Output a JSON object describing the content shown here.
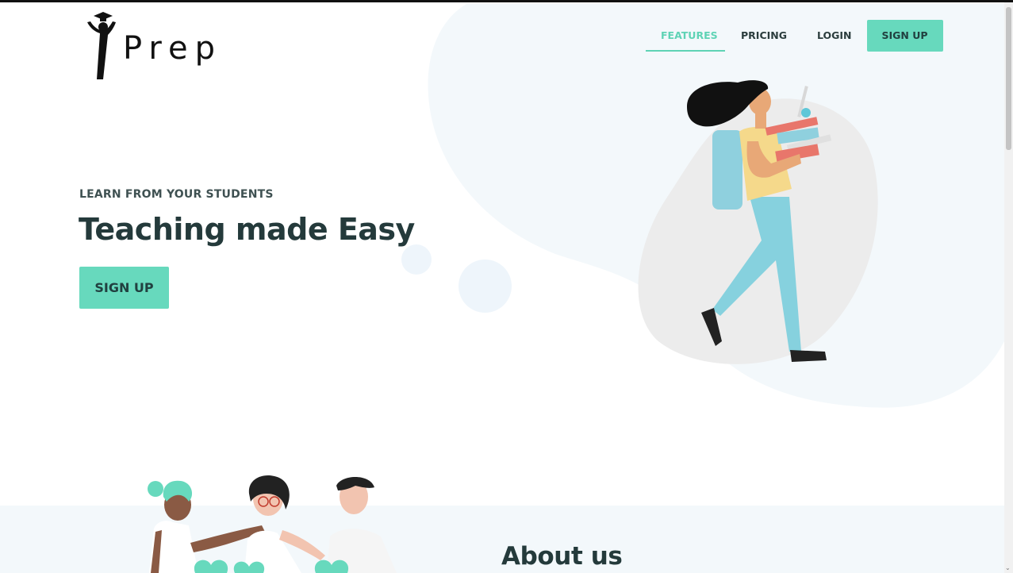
{
  "brand": {
    "name": "Prep",
    "logo_icon": "graduate-figure-icon"
  },
  "nav": {
    "items": [
      {
        "label": "FEATURES",
        "active": true
      },
      {
        "label": "PRICING",
        "active": false
      },
      {
        "label": "LOGIN",
        "active": false
      }
    ],
    "cta_label": "SIGN UP"
  },
  "hero": {
    "kicker": "LEARN FROM YOUR STUDENTS",
    "headline": "Teaching made Easy",
    "cta_label": "SIGN UP",
    "illustration": "student-carrying-books-illustration"
  },
  "about": {
    "title": "About us",
    "illustration": "three-friends-illustration"
  },
  "colors": {
    "accent": "#67d9bd",
    "accent_text": "#5fd3b5",
    "heading": "#243a3b",
    "blob": "#f3f8fb"
  }
}
